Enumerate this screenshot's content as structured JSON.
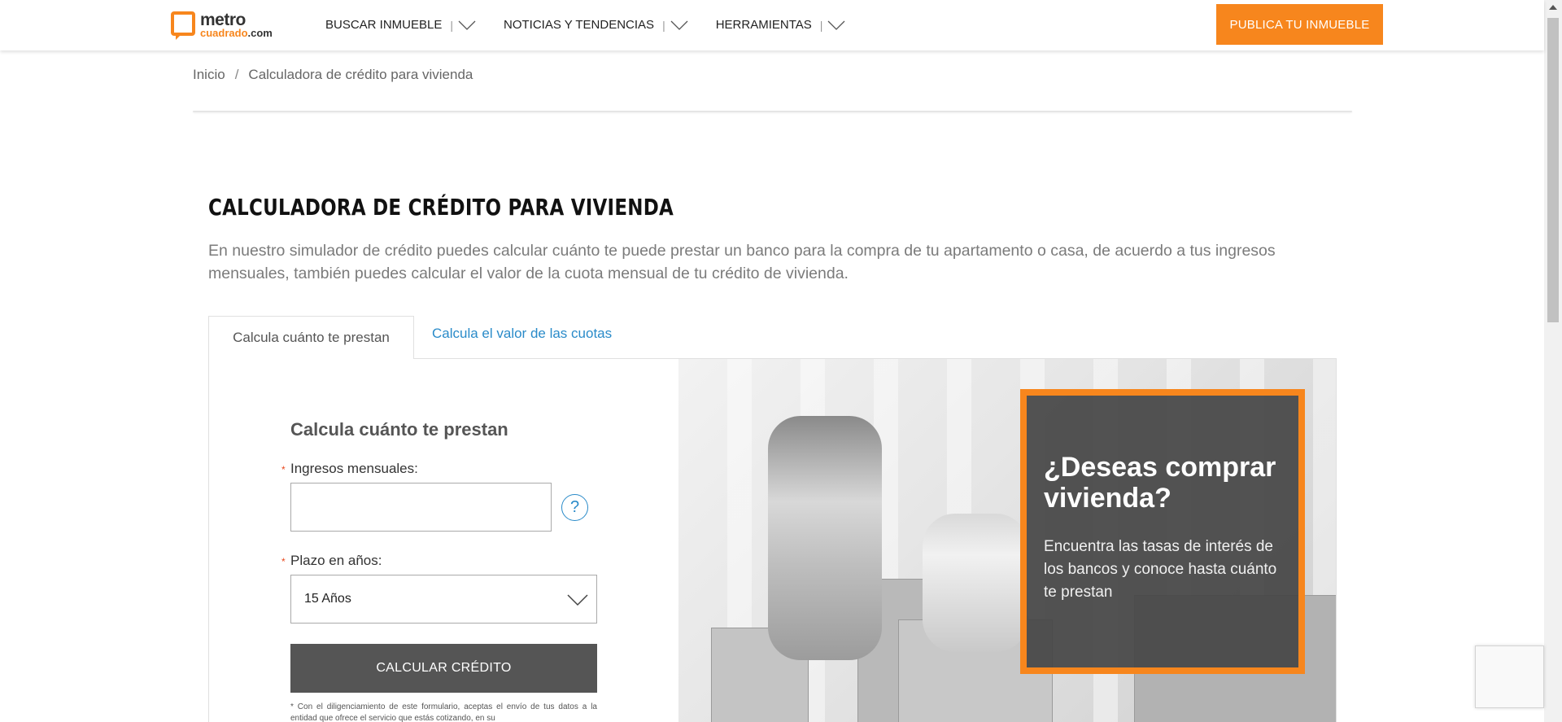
{
  "colors": {
    "accent": "#f7861d",
    "link": "#2a8bc9",
    "button_dark": "#555555"
  },
  "header": {
    "logo_top": "metro",
    "logo_bottom": "cuadrado",
    "logo_suffix": ".com",
    "nav": [
      {
        "label": "BUSCAR INMUEBLE",
        "icon": "chevron-down-icon"
      },
      {
        "label": "NOTICIAS Y TENDENCIAS",
        "icon": "chevron-down-icon"
      },
      {
        "label": "HERRAMIENTAS",
        "icon": "chevron-down-icon"
      }
    ],
    "nav_separator": "|",
    "publish_label": "PUBLICA TU INMUEBLE"
  },
  "breadcrumb": {
    "home": "Inicio",
    "separator": "/",
    "current": "Calculadora de crédito para vivienda"
  },
  "page": {
    "title": "CALCULADORA DE CRÉDITO PARA VIVIENDA",
    "intro": "En nuestro simulador de crédito puedes calcular cuánto te puede prestar un banco para la compra de tu apartamento o casa, de acuerdo a tus ingresos mensuales, también puedes calcular el valor de la cuota mensual de tu crédito de vivienda."
  },
  "tabs": [
    {
      "label": "Calcula cuánto te prestan",
      "active": true
    },
    {
      "label": "Calcula el valor de las cuotas",
      "active": false
    }
  ],
  "form": {
    "title": "Calcula cuánto te prestan",
    "required_mark": "*",
    "income_label": "Ingresos mensuales:",
    "income_value": "",
    "help_symbol": "?",
    "term_label": "Plazo en años:",
    "term_selected": "15 Años",
    "submit_label": "CALCULAR CRÉDITO",
    "disclaimer": "* Con el diligenciamiento de este formulario, aceptas el envío de tus datos a la entidad que ofrece el servicio que estás cotizando, en su"
  },
  "promo": {
    "title": "¿Deseas comprar vivienda?",
    "text": "Encuentra las tasas de interés de los bancos y conoce hasta cuánto te prestan"
  }
}
